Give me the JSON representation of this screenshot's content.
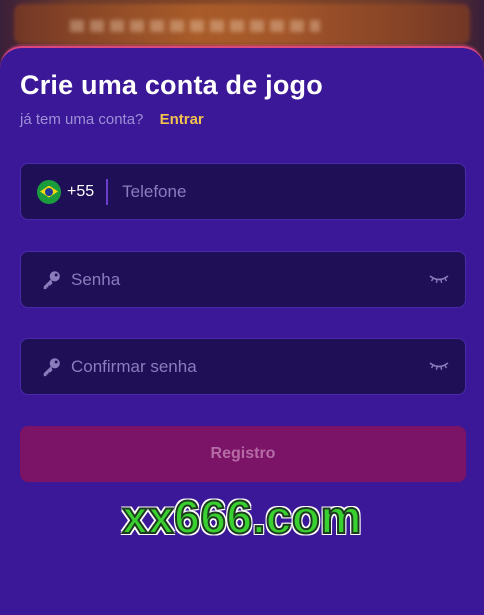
{
  "form": {
    "title": "Crie uma conta de jogo",
    "subtitle": "já tem uma conta?",
    "login_link": "Entrar"
  },
  "phone_field": {
    "flag": "brazil-flag-icon",
    "country_code": "+55",
    "placeholder": "Telefone"
  },
  "password_field": {
    "icon": "key-icon",
    "placeholder": "Senha",
    "toggle_icon": "eye-closed-icon"
  },
  "confirm_field": {
    "icon": "key-icon",
    "placeholder": "Confirmar senha",
    "toggle_icon": "eye-closed-icon"
  },
  "register_button": {
    "label": "Registro"
  },
  "watermark": {
    "text": "xx666.com"
  },
  "colors": {
    "panel": "#3b1897",
    "field": "#1e0f57",
    "accent_link": "#f2c14e",
    "button": "#7b1366",
    "watermark": "#39d12f"
  }
}
